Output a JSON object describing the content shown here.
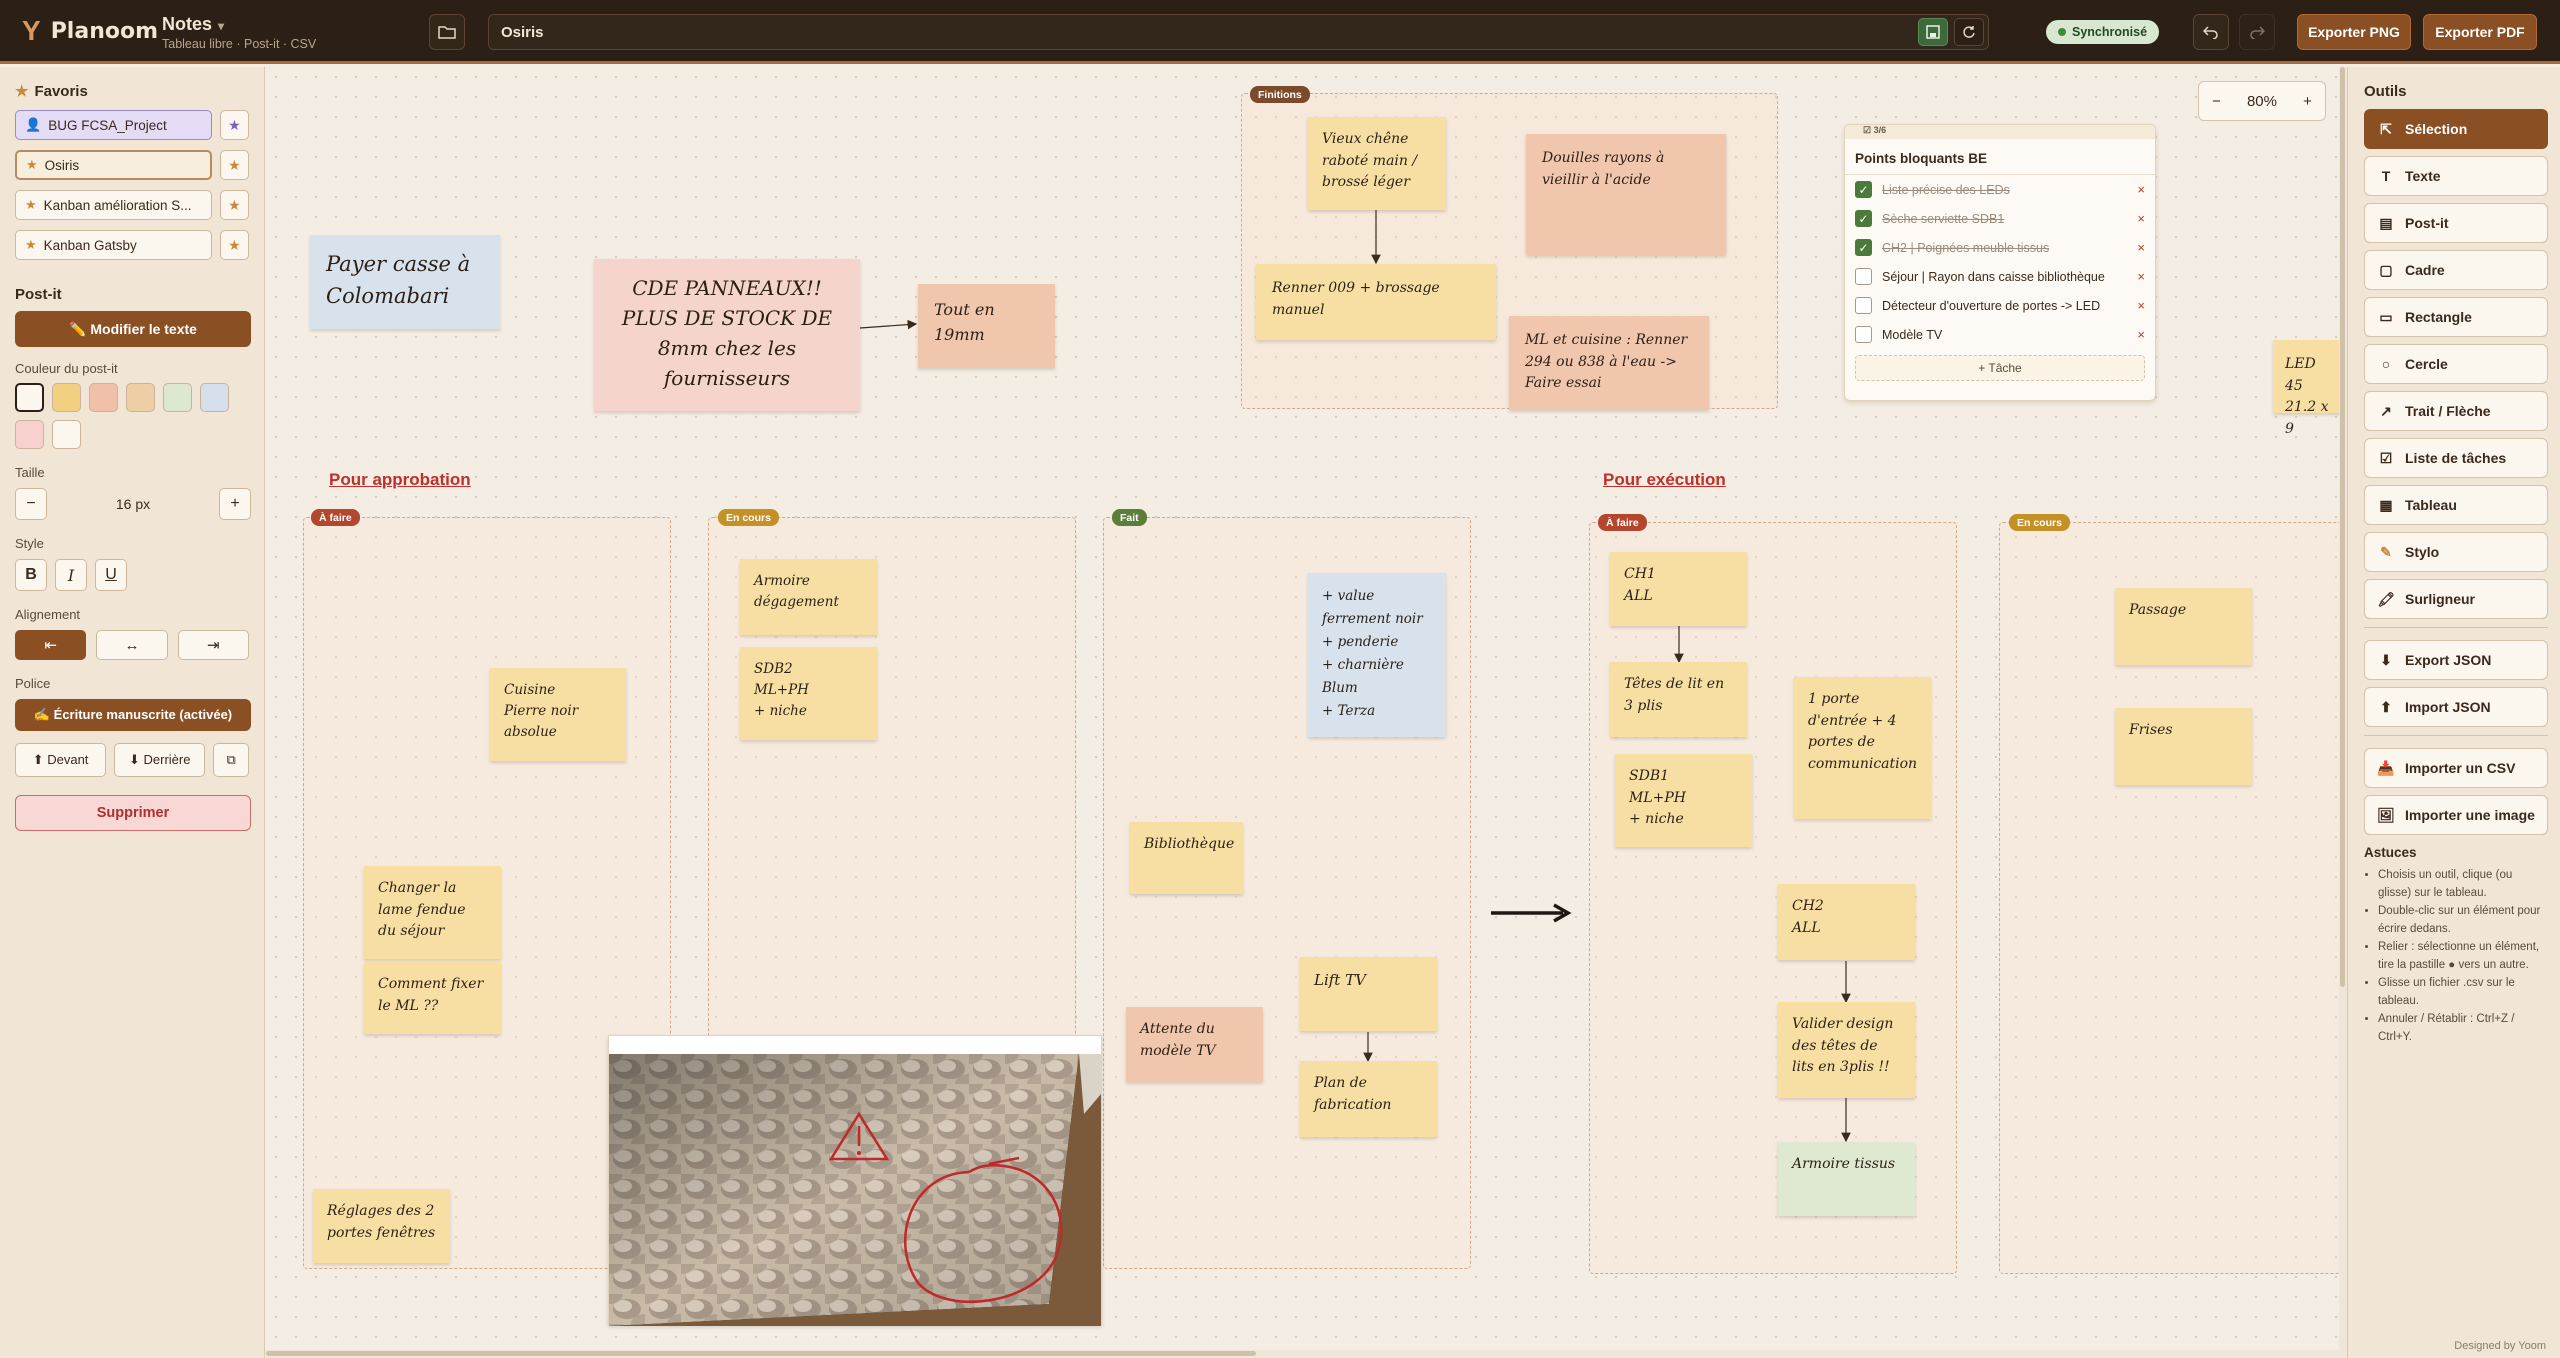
{
  "topbar": {
    "logo_mark": "Y",
    "logo_name": "Planoom",
    "doc_title": "Notes",
    "doc_title_caret": "▾",
    "doc_subtitle": "Tableau libre · Post-it · CSV",
    "board_name": "Osiris",
    "sync_status": "Synchronisé",
    "export_png": "Exporter PNG",
    "export_pdf": "Exporter PDF"
  },
  "left_panel": {
    "favorites_title": "Favoris",
    "favorites": [
      {
        "label": "BUG FCSA_Project",
        "icon": "user-icon"
      },
      {
        "label": "Osiris",
        "icon": "star-icon"
      },
      {
        "label": "Kanban amélioration S...",
        "icon": "star-icon"
      },
      {
        "label": "Kanban Gatsby",
        "icon": "star-icon"
      }
    ],
    "postit_title": "Post-it",
    "edit_text_button": "✏️ Modifier le texte",
    "color_label": "Couleur du post-it",
    "colors": [
      "#fbf6ee",
      "#f3cf82",
      "#f2c0a8",
      "#eecea4",
      "#dbe8cf",
      "#d5e0ec",
      "#f8d0cd",
      "#fbf7ef"
    ],
    "size_label": "Taille",
    "size_value": "16 px",
    "style_label": "Style",
    "style_bold": "B",
    "style_italic": "I",
    "style_underline": "U",
    "align_label": "Alignement",
    "align_left": "⇤",
    "align_center": "↔",
    "align_right": "⇥",
    "font_label": "Police",
    "font_button": "✍ Écriture manuscrite (activée)",
    "front_button": "⬆ Devant",
    "back_button": "⬇ Derrière",
    "delete_button": "Supprimer"
  },
  "right_panel": {
    "tools_title": "Outils",
    "tools": [
      {
        "label": "Sélection",
        "icon": "cursor-icon",
        "glyph": "⇱"
      },
      {
        "label": "Texte",
        "icon": "text-icon",
        "glyph": "T"
      },
      {
        "label": "Post-it",
        "icon": "postit-icon",
        "glyph": "▤"
      },
      {
        "label": "Cadre",
        "icon": "frame-icon",
        "glyph": "▢"
      },
      {
        "label": "Rectangle",
        "icon": "rectangle-icon",
        "glyph": "▭"
      },
      {
        "label": "Cercle",
        "icon": "circle-icon",
        "glyph": "○"
      },
      {
        "label": "Trait / Flèche",
        "icon": "arrow-icon",
        "glyph": "↗"
      },
      {
        "label": "Liste de tâches",
        "icon": "checklist-icon",
        "glyph": "☑"
      },
      {
        "label": "Tableau",
        "icon": "table-icon",
        "glyph": "▦"
      },
      {
        "label": "Stylo",
        "icon": "pen-icon",
        "glyph": "✎"
      },
      {
        "label": "Surligneur",
        "icon": "highlighter-icon",
        "glyph": "🖍"
      }
    ],
    "export_json": "Export JSON",
    "import_json": "Import JSON",
    "import_csv": "Importer un CSV",
    "import_image": "Importer une image",
    "tips_title": "Astuces",
    "tips": [
      "Choisis un outil, clique (ou glisse) sur le tableau.",
      "Double-clic sur un élément pour écrire dedans.",
      "Relier : sélectionne un élément, tire la pastille ● vers un autre.",
      "Glisse un fichier .csv sur le tableau.",
      "Annuler / Rétablir : Ctrl+Z / Ctrl+Y."
    ],
    "designed_by": "Designed by Yoom"
  },
  "canvas": {
    "zoom": "80%",
    "zoom_minus": "−",
    "zoom_plus": "+",
    "section_approbation": "Pour approbation",
    "section_execution": "Pour exécution",
    "tags": {
      "finitions": "Finitions",
      "a_faire_1": "À faire",
      "en_cours_1": "En cours",
      "fait": "Fait",
      "a_faire_2": "À faire",
      "en_cours_2": "En cours"
    },
    "notes": {
      "payer": "Payer casse à Colomabari",
      "cde": "CDE PANNEAUX!! PLUS DE STOCK DE 8mm chez les fournisseurs",
      "tout19": "Tout en 19mm",
      "vieux_chene": "Vieux chêne\nraboté main /\nbrossé léger",
      "renner009": "Renner 009 + brossage manuel",
      "douilles": "Douilles rayons à vieillir à l'acide",
      "ml_cuisine": "ML et cuisine : Renner 294 ou 838 à l'eau -> Faire essai",
      "led": "LED 45\n21.2 x 9",
      "cuisine": "Cuisine\nPierre noir\nabsolue",
      "changer_lame": "Changer la lame fendue du séjour",
      "comment_fixer": "Comment fixer le ML ??",
      "reglages": "Réglages des 2 portes fenêtres",
      "armoire_degagement": "Armoire\ndégagement",
      "sdb2": "SDB2\nML+PH\n+ niche",
      "value_ferrement": "+ value ferrement noir\n+ penderie\n+ charnière Blum\n+ Terza",
      "bibliotheque": "Bibliothèque",
      "attente": "Attente du modèle TV",
      "lift_tv": "Lift TV",
      "plan_fab": "Plan de fabrication",
      "ch1": "CH1\nALL",
      "tetes_lit": "Têtes de lit en 3 plis",
      "sdb1": "SDB1\nML+PH\n+ niche",
      "porte_entree": "1 porte d'entrée + 4 portes de communication",
      "ch2": "CH2\nALL",
      "valider": "Valider design des têtes de lits en 3plis !!",
      "armoire_tissus": "Armoire tissus",
      "passage": "Passage",
      "frises": "Frises"
    },
    "checklist": {
      "badge": "☑ 3/6",
      "title": "Points bloquants BE",
      "items": [
        {
          "text": "Liste précise des LEDs",
          "done": true
        },
        {
          "text": "Sèche serviette SDB1",
          "done": true
        },
        {
          "text": "CH2 | Poignées meuble tissus",
          "done": true
        },
        {
          "text": "Séjour | Rayon dans caisse bibliothèque",
          "done": false
        },
        {
          "text": "Détecteur d'ouverture de portes -> LED",
          "done": false
        },
        {
          "text": "Modèle TV",
          "done": false
        }
      ],
      "add_task": "+ Tâche"
    }
  }
}
